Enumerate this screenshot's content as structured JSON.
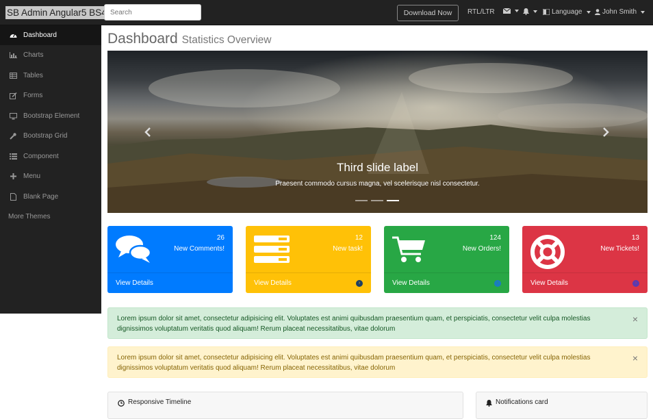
{
  "navbar": {
    "brand": "SB Admin Angular5 BS4",
    "search_placeholder": "Search",
    "download_label": "Download Now",
    "rtl_label": "RTL/LTR",
    "language_label": "Language",
    "user_name": "John Smith"
  },
  "sidebar": {
    "items": [
      {
        "label": "Dashboard",
        "icon": "dashboard-icon"
      },
      {
        "label": "Charts",
        "icon": "bar-chart-icon"
      },
      {
        "label": "Tables",
        "icon": "table-icon"
      },
      {
        "label": "Forms",
        "icon": "edit-icon"
      },
      {
        "label": "Bootstrap Element",
        "icon": "desktop-icon"
      },
      {
        "label": "Bootstrap Grid",
        "icon": "wrench-icon"
      },
      {
        "label": "Component",
        "icon": "list-icon"
      },
      {
        "label": "Menu",
        "icon": "plus-icon"
      },
      {
        "label": "Blank Page",
        "icon": "file-icon"
      },
      {
        "label": "More Themes",
        "icon": ""
      }
    ]
  },
  "page": {
    "title": "Dashboard",
    "subtitle": "Statistics Overview"
  },
  "carousel": {
    "title": "Third slide label",
    "text": "Praesent commodo cursus magna, vel scelerisque nisl consectetur.",
    "active_slide": 3,
    "slide_count": 3
  },
  "cards": [
    {
      "count": "26",
      "text": "New Comments!",
      "link": "View Details",
      "color": "#007bff",
      "icon": "comments-icon"
    },
    {
      "count": "12",
      "text": "New task!",
      "link": "View Details",
      "color": "#ffc107",
      "icon": "tasks-icon"
    },
    {
      "count": "124",
      "text": "New Orders!",
      "link": "View Details",
      "color": "#28a745",
      "icon": "shopping-cart-icon"
    },
    {
      "count": "13",
      "text": "New Tickets!",
      "link": "View Details",
      "color": "#dc3545",
      "icon": "life-ring-icon"
    }
  ],
  "alerts": [
    {
      "type": "success",
      "text": "Lorem ipsum dolor sit amet, consectetur adipisicing elit. Voluptates est animi quibusdam praesentium quam, et perspiciatis, consectetur velit culpa molestias dignissimos voluptatum veritatis quod aliquam! Rerum placeat necessitatibus, vitae dolorum"
    },
    {
      "type": "warning",
      "text": "Lorem ipsum dolor sit amet, consectetur adipisicing elit. Voluptates est animi quibusdam praesentium quam, et perspiciatis, consectetur velit culpa molestias dignissimos voluptatum veritatis quod aliquam! Rerum placeat necessitatibus, vitae dolorum"
    }
  ],
  "panels": {
    "timeline_title": "Responsive Timeline",
    "notifications_title": "Notifications card"
  }
}
